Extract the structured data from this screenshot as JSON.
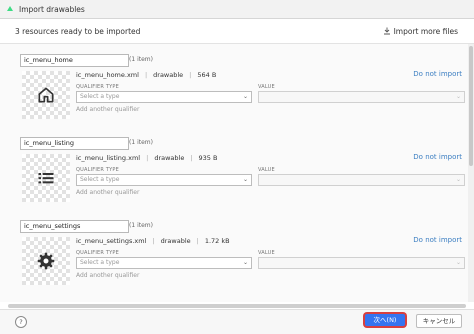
{
  "window": {
    "title": "Import drawables"
  },
  "header": {
    "summary": "3 resources ready to be imported",
    "import_more": "Import more files"
  },
  "labels": {
    "qualifier_type": "QUALIFIER TYPE",
    "value": "VALUE",
    "select_placeholder": "Select a type",
    "add_qualifier": "Add another qualifier",
    "do_not_import": "Do not import"
  },
  "resources": [
    {
      "name": "ic_menu_home",
      "count": "(1 item)",
      "file": "ic_menu_home.xml",
      "type": "drawable",
      "size": "564 B",
      "icon": "home-icon"
    },
    {
      "name": "ic_menu_listing",
      "count": "(1 item)",
      "file": "ic_menu_listing.xml",
      "type": "drawable",
      "size": "935 B",
      "icon": "list-icon"
    },
    {
      "name": "ic_menu_settings",
      "count": "(1 item)",
      "file": "ic_menu_settings.xml",
      "type": "drawable",
      "size": "1.72 kB",
      "icon": "gear-icon"
    }
  ],
  "footer": {
    "help": "?",
    "next": "次へ(N)",
    "cancel": "キャンセル"
  },
  "colors": {
    "accent": "#3574f0",
    "link": "#3d7fc2",
    "highlight": "#d84040"
  }
}
